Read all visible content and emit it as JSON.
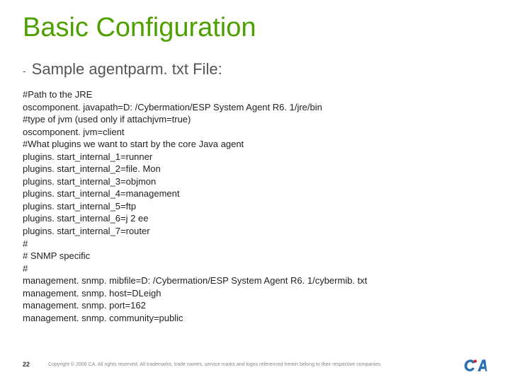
{
  "title": "Basic Configuration",
  "subtitle_dash": "-",
  "subtitle": "Sample agentparm. txt File:",
  "body_lines": [
    "#Path to the JRE",
    "oscomponent. javapath=D: /Cybermation/ESP System Agent R6. 1/jre/bin",
    "#type of jvm (used only if attachjvm=true)",
    "oscomponent. jvm=client",
    "#What plugins we want to start by the core Java agent",
    "plugins. start_internal_1=runner",
    "plugins. start_internal_2=file. Mon",
    "plugins. start_internal_3=objmon",
    "plugins. start_internal_4=management",
    "plugins. start_internal_5=ftp",
    "plugins. start_internal_6=j 2 ee",
    "plugins. start_internal_7=router",
    "#",
    "# SNMP specific",
    "#",
    "management. snmp. mibfile=D: /Cybermation/ESP System Agent R6. 1/cybermib. txt",
    "management. snmp. host=DLeigh",
    "management. snmp. port=162",
    "management. snmp. community=public"
  ],
  "page_number": "22",
  "copyright": "Copyright © 2006 CA. All rights reserved. All trademarks, trade names, service marks and logos referenced herein belong to their respective companies.",
  "logo_name": "ca"
}
